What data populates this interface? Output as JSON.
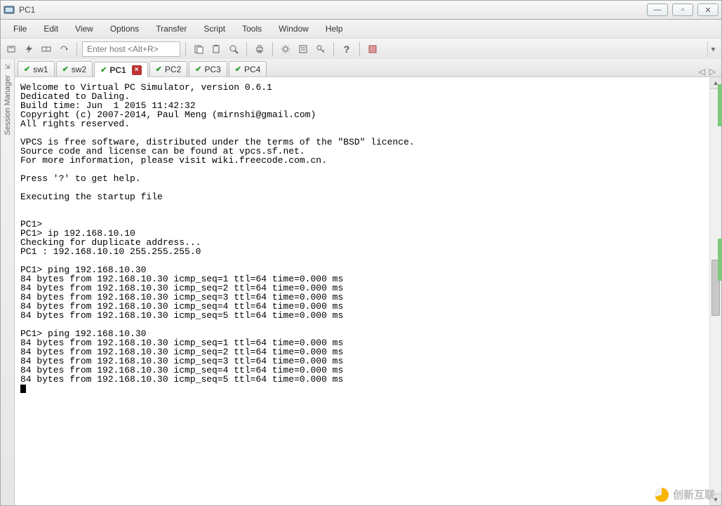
{
  "window": {
    "title": "PC1"
  },
  "menu": {
    "file": "File",
    "edit": "Edit",
    "view": "View",
    "options": "Options",
    "transfer": "Transfer",
    "script": "Script",
    "tools": "Tools",
    "window": "Window",
    "help": "Help"
  },
  "toolbar": {
    "host_placeholder": "Enter host <Alt+R>",
    "icons": {
      "connect": "connect-icon",
      "quick": "lightning-icon",
      "loop": "reconnect-icon",
      "disc": "disconnect-icon",
      "copy": "copy-icon",
      "paste": "paste-icon",
      "find": "find-icon",
      "print": "print-icon",
      "settings": "gear-icon",
      "props": "properties-icon",
      "key": "key-icon",
      "helpq": "help-icon",
      "last": "extra-icon"
    }
  },
  "sidebar": {
    "label": "Session Manager"
  },
  "tabs": [
    {
      "label": "sw1",
      "active": false,
      "closeable": false
    },
    {
      "label": "sw2",
      "active": false,
      "closeable": false
    },
    {
      "label": "PC1",
      "active": true,
      "closeable": true
    },
    {
      "label": "PC2",
      "active": false,
      "closeable": false
    },
    {
      "label": "PC3",
      "active": false,
      "closeable": false
    },
    {
      "label": "PC4",
      "active": false,
      "closeable": false
    }
  ],
  "tabs_nav": {
    "left": "◁",
    "right": "▷"
  },
  "terminal": {
    "lines": [
      "Welcome to Virtual PC Simulator, version 0.6.1",
      "Dedicated to Daling.",
      "Build time: Jun  1 2015 11:42:32",
      "Copyright (c) 2007-2014, Paul Meng (mirnshi@gmail.com)",
      "All rights reserved.",
      "",
      "VPCS is free software, distributed under the terms of the \"BSD\" licence.",
      "Source code and license can be found at vpcs.sf.net.",
      "For more information, please visit wiki.freecode.com.cn.",
      "",
      "Press '?' to get help.",
      "",
      "Executing the startup file",
      "",
      "",
      "PC1>",
      "PC1> ip 192.168.10.10",
      "Checking for duplicate address...",
      "PC1 : 192.168.10.10 255.255.255.0",
      "",
      "PC1> ping 192.168.10.30",
      "84 bytes from 192.168.10.30 icmp_seq=1 ttl=64 time=0.000 ms",
      "84 bytes from 192.168.10.30 icmp_seq=2 ttl=64 time=0.000 ms",
      "84 bytes from 192.168.10.30 icmp_seq=3 ttl=64 time=0.000 ms",
      "84 bytes from 192.168.10.30 icmp_seq=4 ttl=64 time=0.000 ms",
      "84 bytes from 192.168.10.30 icmp_seq=5 ttl=64 time=0.000 ms",
      "",
      "PC1> ping 192.168.10.30",
      "84 bytes from 192.168.10.30 icmp_seq=1 ttl=64 time=0.000 ms",
      "84 bytes from 192.168.10.30 icmp_seq=2 ttl=64 time=0.000 ms",
      "84 bytes from 192.168.10.30 icmp_seq=3 ttl=64 time=0.000 ms",
      "84 bytes from 192.168.10.30 icmp_seq=4 ttl=64 time=0.000 ms",
      "84 bytes from 192.168.10.30 icmp_seq=5 ttl=64 time=0.000 ms"
    ]
  },
  "watermark": {
    "text": "创新互联"
  }
}
